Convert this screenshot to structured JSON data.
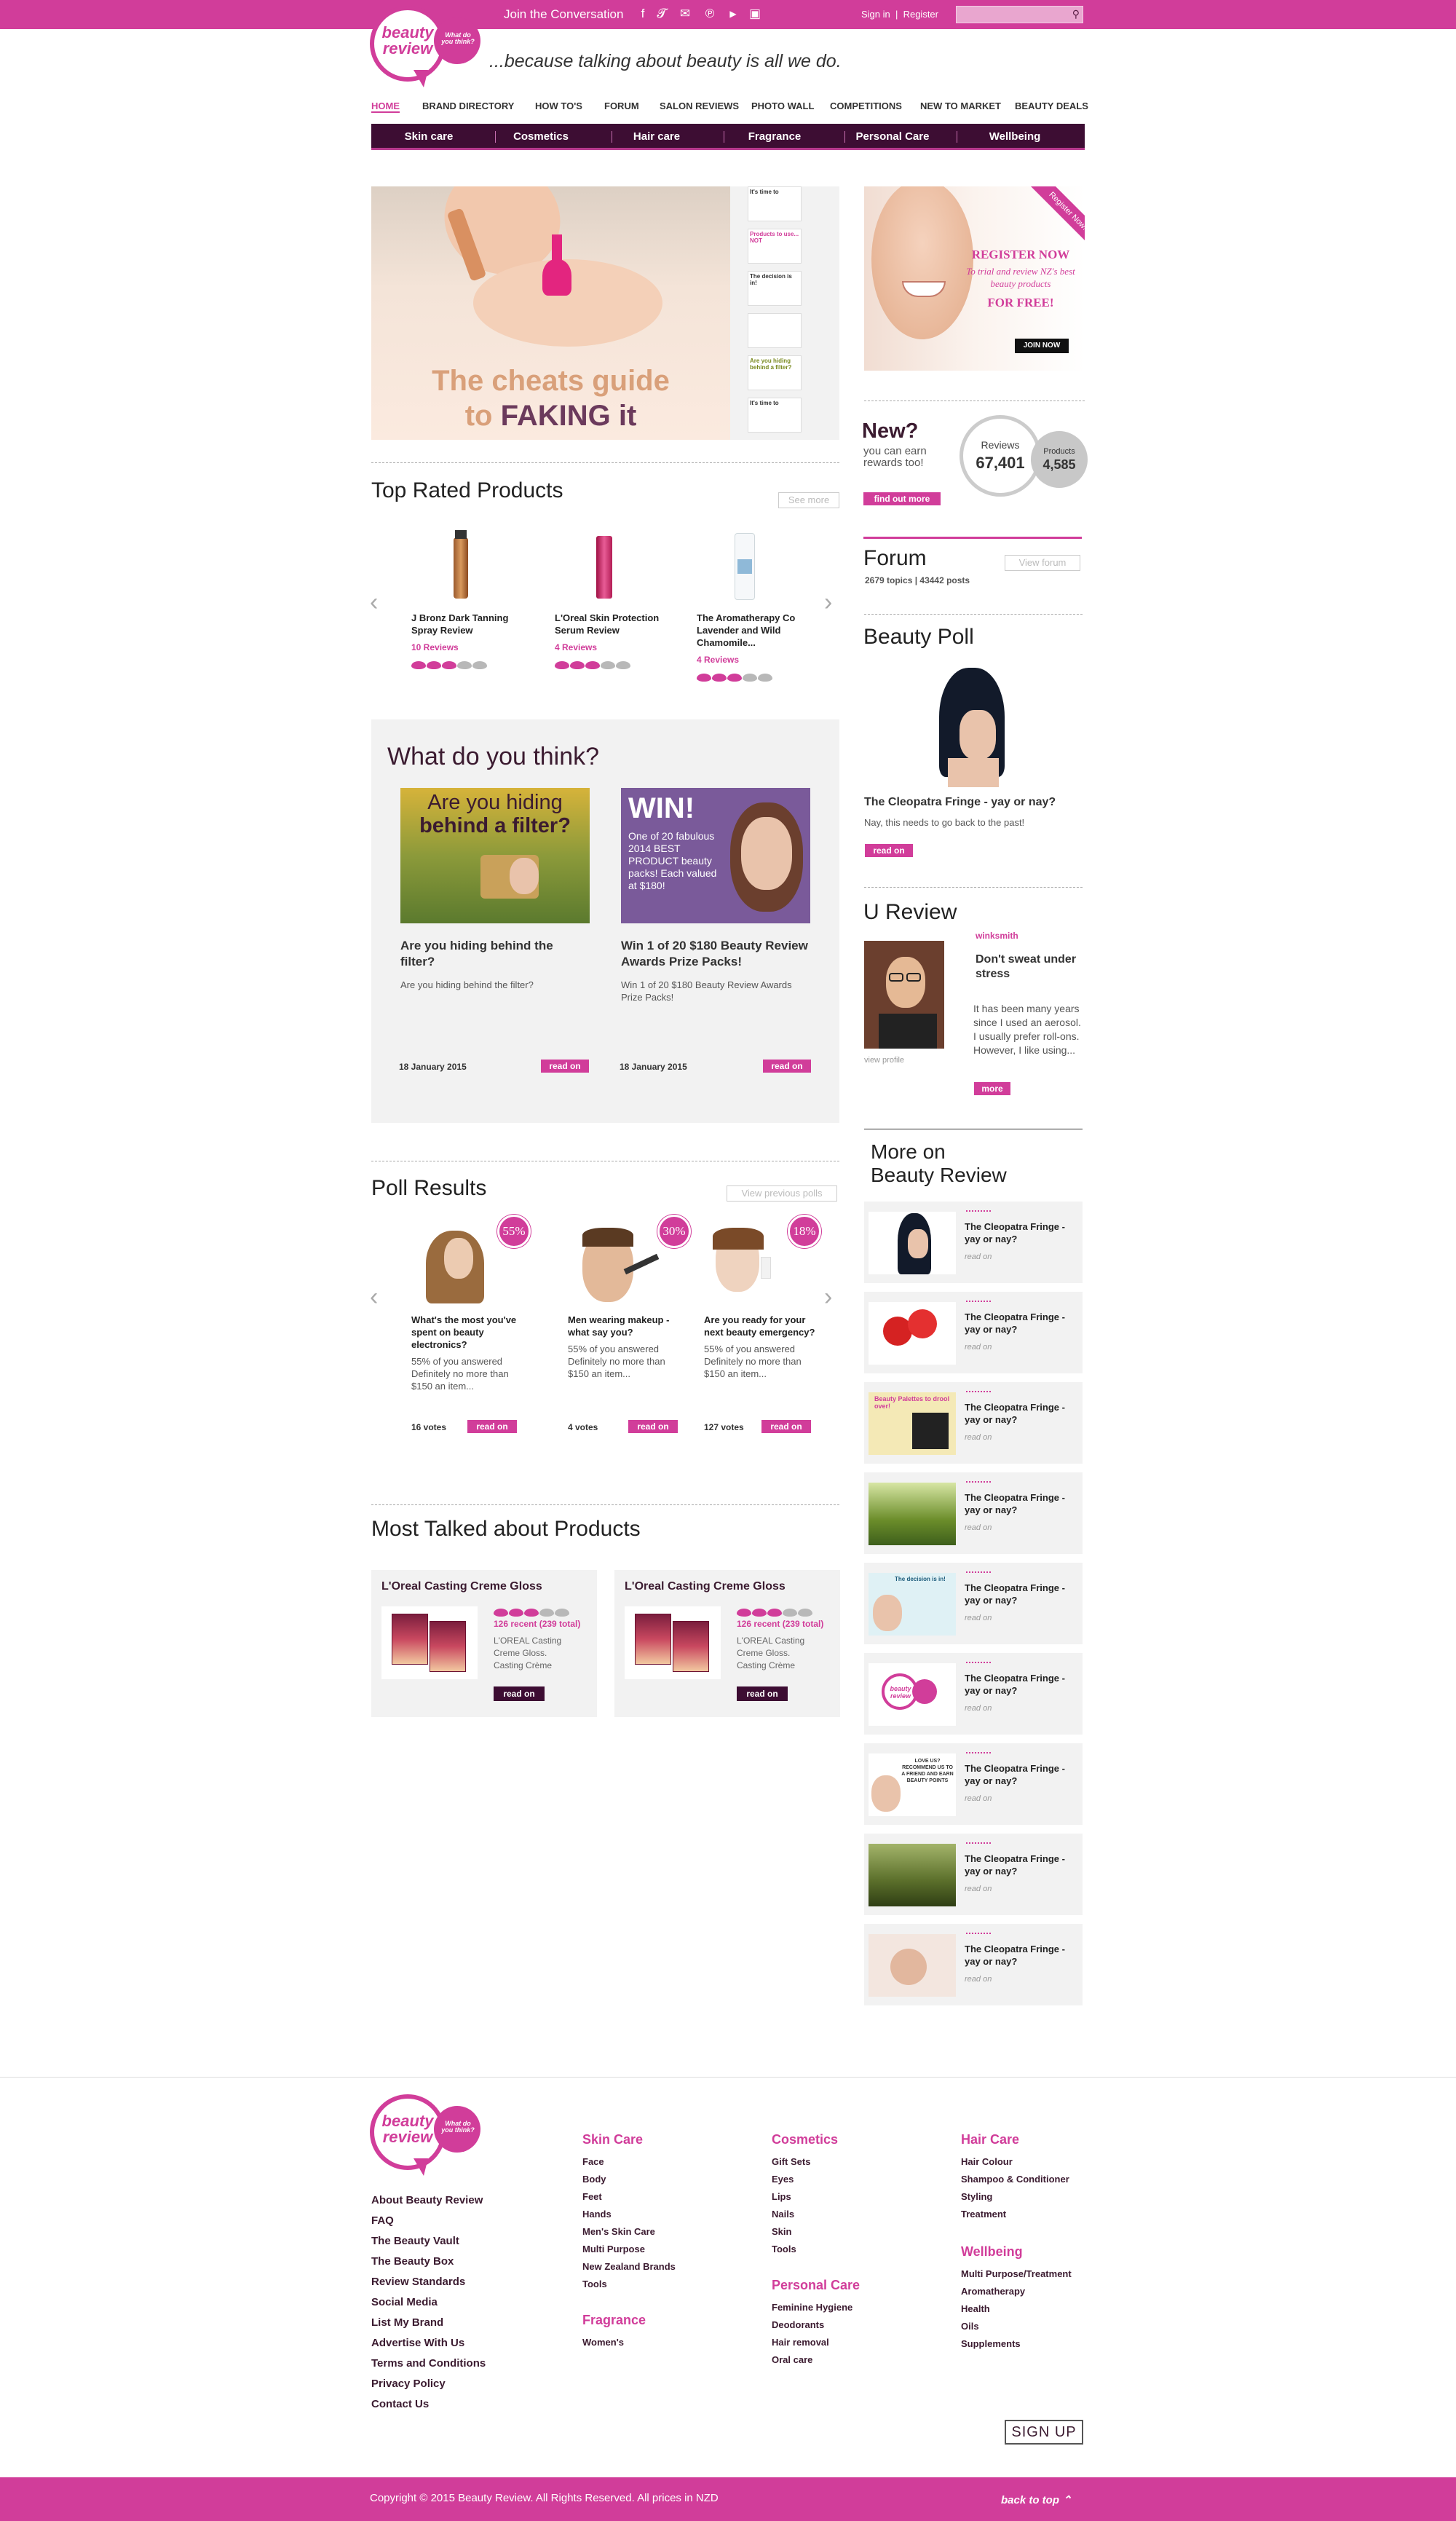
{
  "topbar": {
    "join_text": "Join the Conversation",
    "sign_in": "Sign in",
    "register": "Register",
    "search_placeholder": ""
  },
  "header": {
    "logo_text": "beauty review",
    "logo_bubble": "What do you think?",
    "tagline": "...because talking about beauty is all we do."
  },
  "nav": [
    "HOME",
    "BRAND DIRECTORY",
    "HOW TO'S",
    "FORUM",
    "SALON REVIEWS",
    "PHOTO WALL",
    "COMPETITIONS",
    "NEW TO MARKET",
    "BEAUTY DEALS"
  ],
  "subnav": [
    "Skin care",
    "Cosmetics",
    "Hair care",
    "Fragrance",
    "Personal Care",
    "Wellbeing"
  ],
  "hero": {
    "line1": "The cheats guide",
    "line2a": "to",
    "line2b": "FAKING it",
    "thumbs": [
      "It's time to",
      "Products to use... NOT",
      "The decision is in!",
      "",
      "Are you hiding behind a filter?",
      "It's time to"
    ]
  },
  "register_ad": {
    "ribbon": "Register Now!",
    "title": "REGISTER NOW",
    "text": "To trial and review NZ's best beauty products",
    "free": "FOR FREE!",
    "join": "JOIN NOW"
  },
  "rewards": {
    "heading": "New?",
    "text": "you can earn rewards too!",
    "button": "find out more",
    "reviews_label": "Reviews",
    "reviews_count": "67,401",
    "products_label": "Products",
    "products_count": "4,585"
  },
  "forum": {
    "heading": "Forum",
    "button": "View forum",
    "stats": "2679 topics | 43442 posts"
  },
  "beauty_poll": {
    "heading": "Beauty Poll",
    "title": "The Cleopatra Fringe - yay or nay?",
    "text": "Nay, this needs to go back to the past!"
  },
  "u_review": {
    "heading": "U Review",
    "user": "winksmith",
    "title": "Don't sweat under stress",
    "excerpt": "It has been many years since I used an aerosol. I usually prefer roll-ons. However, I like using...",
    "view_profile": "view profile",
    "more": "more"
  },
  "more_on": {
    "heading1": "More on",
    "heading2": "Beauty Review",
    "items": [
      {
        "title": "The Cleopatra Fringe - yay or nay?",
        "read": "read on"
      },
      {
        "title": "The Cleopatra Fringe - yay or nay?",
        "read": "read on"
      },
      {
        "title": "The Cleopatra Fringe - yay or nay?",
        "read": "read on",
        "img_text": "Beauty Palettes to drool over!"
      },
      {
        "title": "The Cleopatra Fringe - yay or nay?",
        "read": "read on"
      },
      {
        "title": "The Cleopatra Fringe - yay or nay?",
        "read": "read on",
        "img_text": "The decision is in!"
      },
      {
        "title": "The Cleopatra Fringe - yay or nay?",
        "read": "read on"
      },
      {
        "title": "The Cleopatra Fringe - yay or nay?",
        "read": "read on",
        "img_text": "LOVE US? RECOMMEND US TO A FRIEND AND EARN BEAUTY POINTS"
      },
      {
        "title": "The Cleopatra Fringe - yay or nay?",
        "read": "read on"
      },
      {
        "title": "The Cleopatra Fringe - yay or nay?",
        "read": "read on"
      }
    ]
  },
  "top_rated": {
    "heading": "Top Rated Products",
    "button": "See more",
    "products": [
      {
        "name": "J Bronz Dark Tanning Spray Review",
        "reviews": "10 Reviews",
        "rating": 3
      },
      {
        "name": "L'Oreal Skin Protection Serum Review",
        "reviews": "4 Reviews",
        "rating": 3
      },
      {
        "name": "The Aromatherapy Co Lavender and Wild Chamomile...",
        "reviews": "4 Reviews",
        "rating": 3
      }
    ]
  },
  "wdyt": {
    "heading": "What do you think?",
    "cards": [
      {
        "img_line1": "Are you hiding",
        "img_line2": "behind a filter?",
        "title": "Are you hiding behind the filter?",
        "desc": "Are you hiding behind the filter?",
        "date": "18 January 2015"
      },
      {
        "img_win": "WIN!",
        "img_text": "One of 20 fabulous 2014 BEST PRODUCT beauty packs! Each valued at $180!",
        "title": "Win 1 of 20 $180 Beauty Review Awards Prize Packs!",
        "desc": "Win 1 of 20 $180 Beauty Review Awards Prize Packs!",
        "date": "18 January 2015"
      }
    ]
  },
  "poll_results": {
    "heading": "Poll Results",
    "button": "View previous polls",
    "polls": [
      {
        "question": "What's the most you've spent on beauty electronics?",
        "answer": "55% of you answered Definitely no more than $150 an item...",
        "percent": "55%",
        "votes": "16 votes"
      },
      {
        "question": "Men wearing makeup - what say you?",
        "answer": "55% of you answered Definitely no more than $150 an item...",
        "percent": "30%",
        "votes": "4 votes"
      },
      {
        "question": "Are you ready for your next beauty emergency?",
        "answer": "55% of you answered Definitely no more than $150 an item...",
        "percent": "18%",
        "votes": "127 votes"
      }
    ]
  },
  "most_talked": {
    "heading": "Most Talked about Products",
    "items": [
      {
        "name": "L'Oreal Casting Creme Gloss",
        "recent": "126 recent (239 total)",
        "desc": "L'OREAL Casting Creme Gloss. Casting Crème",
        "rating": 3
      },
      {
        "name": "L'Oreal Casting Creme Gloss",
        "recent": "126 recent (239 total)",
        "desc": "L'OREAL Casting Creme Gloss. Casting Crème",
        "rating": 3
      }
    ]
  },
  "common": {
    "read_on": "read on"
  },
  "footer": {
    "links": [
      "About Beauty Review",
      "FAQ",
      "The Beauty Vault",
      "The Beauty Box",
      "Review Standards",
      "Social Media",
      "List My Brand",
      "Advertise With Us",
      "Terms and Conditions",
      "Privacy Policy",
      "Contact Us"
    ],
    "skin_care": {
      "heading": "Skin Care",
      "items": [
        "Face",
        "Body",
        "Feet",
        "Hands",
        "Men's Skin Care",
        "Multi Purpose",
        "New Zealand Brands",
        "Tools"
      ]
    },
    "fragrance": {
      "heading": "Fragrance",
      "items": [
        "Women's"
      ]
    },
    "cosmetics": {
      "heading": "Cosmetics",
      "items": [
        "Gift Sets",
        "Eyes",
        "Lips",
        "Nails",
        "Skin",
        "Tools"
      ]
    },
    "personal_care": {
      "heading": "Personal Care",
      "items": [
        "Feminine Hygiene",
        "Deodorants",
        "Hair removal",
        "Oral care"
      ]
    },
    "hair_care": {
      "heading": "Hair Care",
      "items": [
        "Hair Colour",
        "Shampoo & Conditioner",
        "Styling",
        "Treatment"
      ]
    },
    "wellbeing": {
      "heading": "Wellbeing",
      "items": [
        "Multi Purpose/Treatment",
        "Aromatherapy",
        "Health",
        "Oils",
        "Supplements"
      ]
    },
    "sign_up": "SIGN UP",
    "copyright": "Copyright © 2015 Beauty Review. All Rights Reserved. All prices in NZD",
    "back_to_top": "back to top"
  },
  "colors": {
    "brand_pink": "#d13d9a",
    "dark_purple": "#3d0d33",
    "panel_grey": "#f2f2f2"
  }
}
